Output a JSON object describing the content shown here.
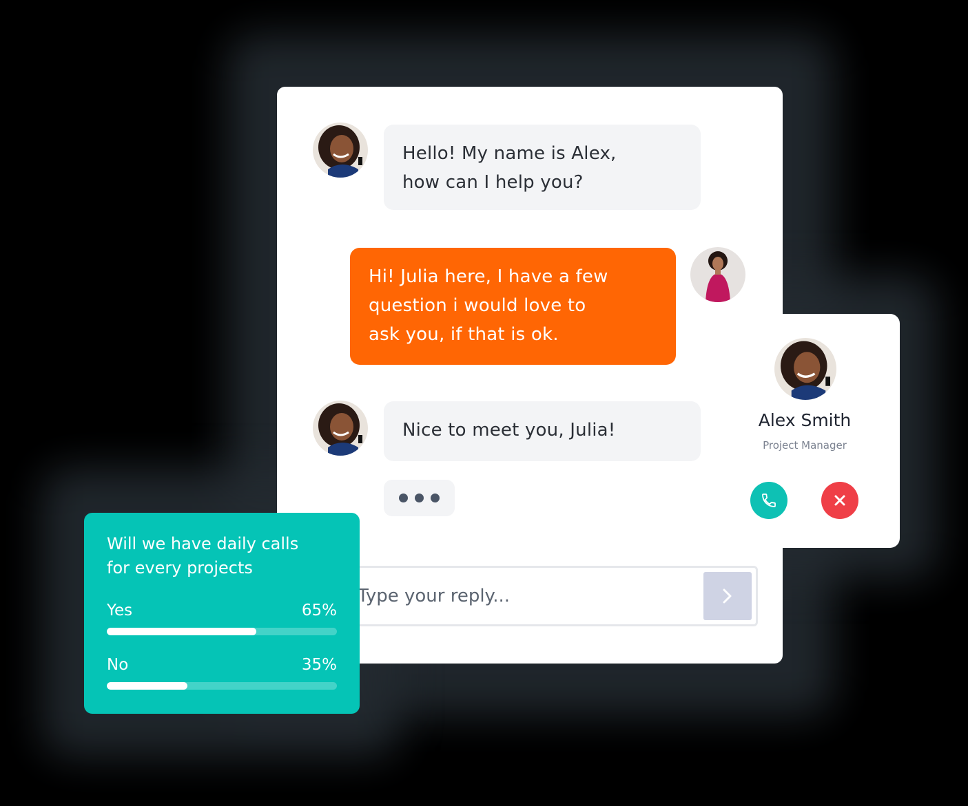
{
  "messages": [
    {
      "sender": "Alex",
      "direction": "incoming",
      "lines": [
        "Hello! My name is Alex,",
        "how can I help you?"
      ]
    },
    {
      "sender": "Julia",
      "direction": "outgoing",
      "lines": [
        "Hi! Julia here, I have a few",
        "question i would love to",
        "ask you, if that is ok."
      ]
    },
    {
      "sender": "Alex",
      "direction": "incoming",
      "lines": [
        "Nice to meet you, Julia!"
      ]
    }
  ],
  "typing_indicator": "typing-dots",
  "reply": {
    "placeholder": "Type your reply...",
    "send_icon": "chevron-right-icon"
  },
  "contact": {
    "name": "Alex Smith",
    "role": "Project Manager",
    "accept_icon": "phone-icon",
    "decline_icon": "close-icon"
  },
  "poll": {
    "question_lines": [
      "Will we have daily calls",
      "for every projects"
    ],
    "options": [
      {
        "label": "Yes",
        "percent_label": "65%",
        "value": 0.65
      },
      {
        "label": "No",
        "percent_label": "35%",
        "value": 0.35
      }
    ]
  },
  "colors": {
    "outgoing_bubble": "#ff6604",
    "incoming_bubble": "#f3f4f6",
    "poll_background": "#05c4b6",
    "accept_call": "#0ec1b4",
    "decline_call": "#ef3f47",
    "send_button": "#cfd3e4"
  }
}
